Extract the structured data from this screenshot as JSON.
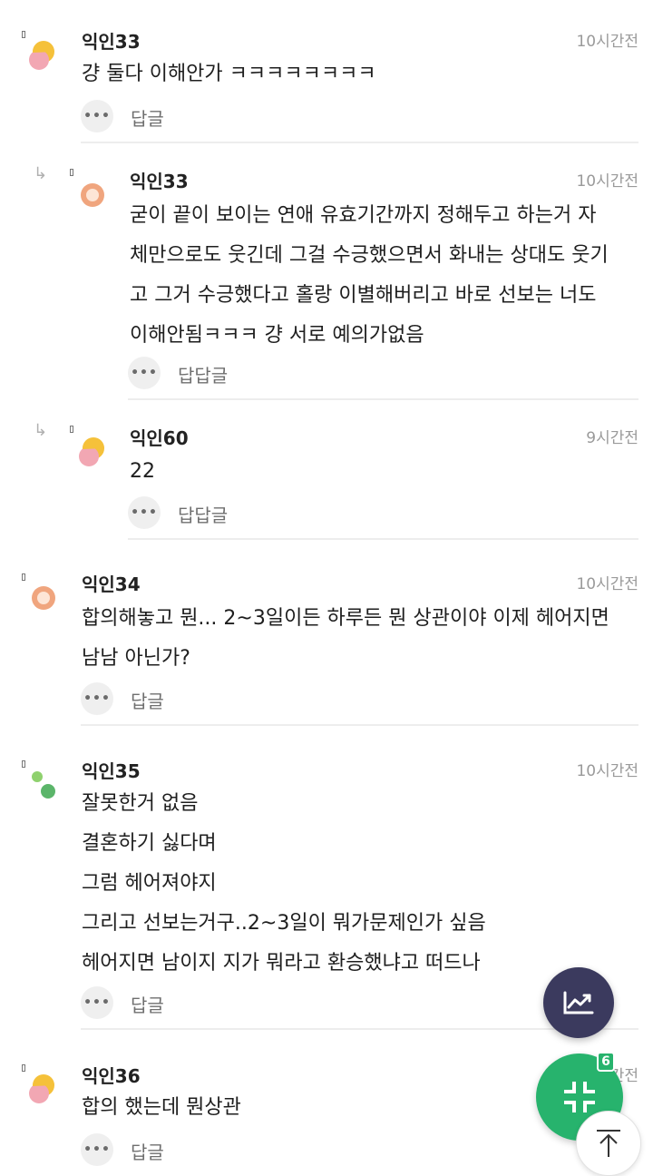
{
  "comments": [
    {
      "nick": "익인33",
      "time": "10시간전",
      "text": "걍 둘다 이해안가 ㅋㅋㅋㅋㅋㅋㅋㅋ",
      "reply_label": "답글"
    },
    {
      "nick": "익인33",
      "time": "10시간전",
      "text": "굳이 끝이 보이는 연애 유효기간까지 정해두고 하는거 자\n체만으로도 웃긴데 그걸 수긍했으면서 화내는 상대도 웃기\n고 그거 수긍했다고 홀랑 이별해버리고 바로 선보는 너도\n이해안됨ㅋㅋㅋ 걍 서로 예의가없음",
      "reply_label": "답답글"
    },
    {
      "nick": "익인60",
      "time": "9시간전",
      "text": "22",
      "reply_label": "답답글"
    },
    {
      "nick": "익인34",
      "time": "10시간전",
      "text": "합의해놓고 뭔... 2~3일이든 하루든 뭔 상관이야 이제 헤어지면\n남남 아닌가?",
      "reply_label": "답글"
    },
    {
      "nick": "익인35",
      "time": "10시간전",
      "text": "잘못한거 없음\n결혼하기 싫다며\n그럼 헤어져야지\n그리고 선보는거구..2~3일이 뭐가문제인가 싶음\n헤어지면 남이지 지가 뭐라고 환승했냐고 떠드나",
      "reply_label": "답글"
    },
    {
      "nick": "익인36",
      "time": "10시간전",
      "text": "합의 했는데 뭔상관",
      "reply_label": "답글"
    }
  ],
  "more_button_glyph": "•••",
  "fab": {
    "badge_count": "6"
  },
  "colors": {
    "fab_chart": "#3b3a5e",
    "fab_green": "#27b36d",
    "avatar_yellow": "#f5c13a",
    "avatar_pink": "#f2a7b3",
    "avatar_orange": "#f0a57e",
    "avatar_green": "#6cc06a"
  }
}
